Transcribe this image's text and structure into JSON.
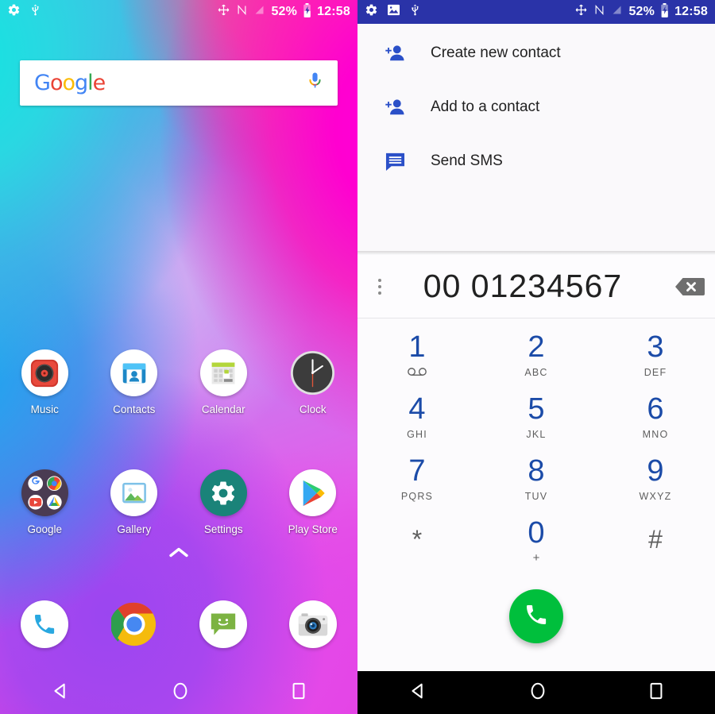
{
  "home": {
    "statusbar": {
      "left_icons": [
        "gear-icon",
        "usb-icon"
      ],
      "right_icons": [
        "move-icon",
        "nfc-icon",
        "signal-off-icon",
        "battery-charging-icon"
      ],
      "battery_text": "52%",
      "clock_text": "12:58"
    },
    "search": {
      "logo_letters": [
        "G",
        "o",
        "o",
        "g",
        "l",
        "e"
      ],
      "mic_icon": "microphone-icon"
    },
    "drawer_indicator": "chevron-up-icon",
    "apps_row1": [
      {
        "label": "Music",
        "icon": "music-app-icon"
      },
      {
        "label": "Contacts",
        "icon": "contacts-app-icon"
      },
      {
        "label": "Calendar",
        "icon": "calendar-app-icon"
      },
      {
        "label": "Clock",
        "icon": "clock-app-icon"
      }
    ],
    "apps_row2": [
      {
        "label": "Google",
        "icon": "google-folder-icon"
      },
      {
        "label": "Gallery",
        "icon": "gallery-app-icon"
      },
      {
        "label": "Settings",
        "icon": "settings-app-icon"
      },
      {
        "label": "Play Store",
        "icon": "play-store-app-icon"
      }
    ],
    "dock": [
      {
        "label": "Phone",
        "icon": "phone-app-icon"
      },
      {
        "label": "Chrome",
        "icon": "chrome-app-icon"
      },
      {
        "label": "Messaging",
        "icon": "messaging-app-icon"
      },
      {
        "label": "Camera",
        "icon": "camera-app-icon"
      }
    ],
    "navbar": [
      "back-icon",
      "home-icon",
      "recents-icon"
    ]
  },
  "dialer": {
    "statusbar": {
      "left_icons": [
        "gear-icon",
        "image-icon",
        "usb-icon"
      ],
      "right_icons": [
        "move-icon",
        "nfc-icon",
        "signal-off-icon",
        "battery-charging-icon"
      ],
      "battery_text": "52%",
      "clock_text": "12:58",
      "background_color": "#2a33a8"
    },
    "menu_items": [
      {
        "label": "Create new contact",
        "icon": "person-add-icon"
      },
      {
        "label": "Add to a contact",
        "icon": "person-add-icon"
      },
      {
        "label": "Send SMS",
        "icon": "message-icon"
      }
    ],
    "number_display": {
      "value": "00 01234567",
      "overflow_icon": "more-vert-icon",
      "backspace_icon": "backspace-icon"
    },
    "keypad": [
      [
        {
          "digit": "1",
          "sub": "",
          "sub_icon": "voicemail-icon"
        },
        {
          "digit": "2",
          "sub": "ABC"
        },
        {
          "digit": "3",
          "sub": "DEF"
        }
      ],
      [
        {
          "digit": "4",
          "sub": "GHI"
        },
        {
          "digit": "5",
          "sub": "JKL"
        },
        {
          "digit": "6",
          "sub": "MNO"
        }
      ],
      [
        {
          "digit": "7",
          "sub": "PQRS"
        },
        {
          "digit": "8",
          "sub": "TUV"
        },
        {
          "digit": "9",
          "sub": "WXYZ"
        }
      ]
    ],
    "keypad_bottom": [
      {
        "symbol": "*",
        "sub": ""
      },
      {
        "symbol": "0",
        "sub": "+"
      },
      {
        "symbol": "#",
        "sub": ""
      }
    ],
    "call_button": {
      "icon": "phone-call-icon",
      "color": "#00bf3c"
    },
    "navbar": [
      "back-icon",
      "home-icon",
      "recents-icon"
    ],
    "digit_color": "#1b4ba8"
  }
}
